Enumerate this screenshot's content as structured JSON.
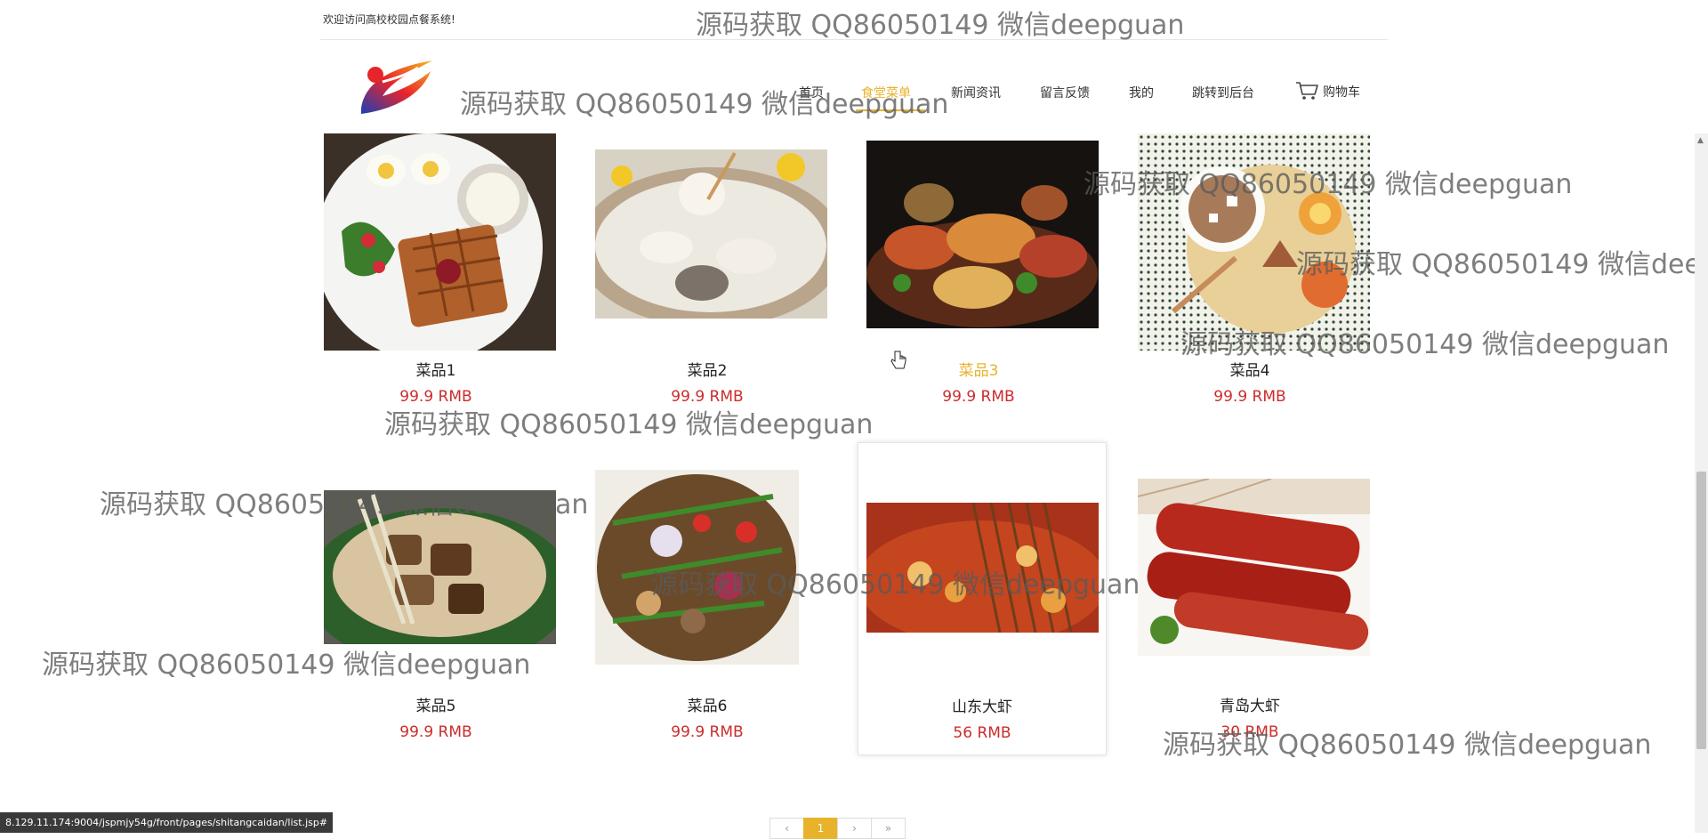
{
  "header": {
    "welcome": "欢迎访问高校校园点餐系统!",
    "nav": [
      "首页",
      "食堂菜单",
      "新闻资讯",
      "留言反馈",
      "我的",
      "跳转到后台"
    ],
    "cart": "购物车"
  },
  "products": [
    {
      "name": "菜品1",
      "price": "99.9 RMB"
    },
    {
      "name": "菜品2",
      "price": "99.9 RMB"
    },
    {
      "name": "菜品3",
      "price": "99.9 RMB"
    },
    {
      "name": "菜品4",
      "price": "99.9 RMB"
    },
    {
      "name": "菜品5",
      "price": "99.9 RMB"
    },
    {
      "name": "菜品6",
      "price": "99.9 RMB"
    },
    {
      "name": "山东大虾",
      "price": "56 RMB"
    },
    {
      "name": "青岛大虾",
      "price": "30 RMB"
    }
  ],
  "pagination": {
    "current": "1"
  },
  "status_url": "8.129.11.174:9004/jspmjy54g/front/pages/shitangcaidan/list.jsp#",
  "watermark": "源码获取 QQ86050149 微信deepguan",
  "colors": {
    "accent": "#e8b32b",
    "price": "#cc2c2c"
  }
}
